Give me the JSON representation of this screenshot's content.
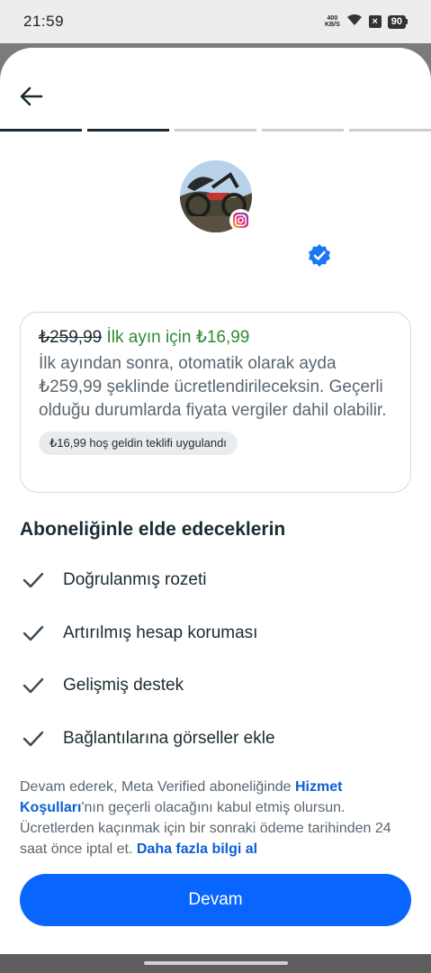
{
  "status_bar": {
    "time": "21:59",
    "net_speed_value": "400",
    "net_speed_unit": "KB/S",
    "battery": "90"
  },
  "icons": {
    "back": "arrow-left-icon",
    "instagram": "instagram-icon",
    "verified": "verified-badge-icon",
    "check": "check-icon"
  },
  "progress": {
    "total_steps": 5,
    "completed_steps": 2
  },
  "offer": {
    "old_price": "₺259,99",
    "promo_text": "İlk ayın için ₺16,99",
    "description": "İlk ayından sonra, otomatik olarak ayda ₺259,99 şeklinde ücretlendirileceksin. Geçerli olduğu durumlarda fiyata vergiler dahil olabilir.",
    "pill": "₺16,99 hoş geldin teklifi uygulandı"
  },
  "benefits": {
    "title": "Aboneliğinle elde edeceklerin",
    "items": [
      {
        "label": "Doğrulanmış rozeti"
      },
      {
        "label": "Artırılmış hesap koruması"
      },
      {
        "label": "Gelişmiş destek"
      },
      {
        "label": "Bağlantılarına görseller ekle"
      }
    ]
  },
  "legal": {
    "part1": "Devam ederek, Meta Verified aboneliğinde ",
    "link1": "Hizmet Koşulları",
    "part2": "'nın geçerli olacağını kabul etmiş olursun. Ücretlerden kaçınmak için bir sonraki ödeme tarihinden 24 saat önce iptal et. ",
    "link2": "Daha fazla bilgi al"
  },
  "continue_label": "Devam",
  "colors": {
    "accent": "#0866ff",
    "promo_green": "#2d8a34",
    "link_blue": "#0b5fd6",
    "verified_blue": "#1877f2"
  }
}
